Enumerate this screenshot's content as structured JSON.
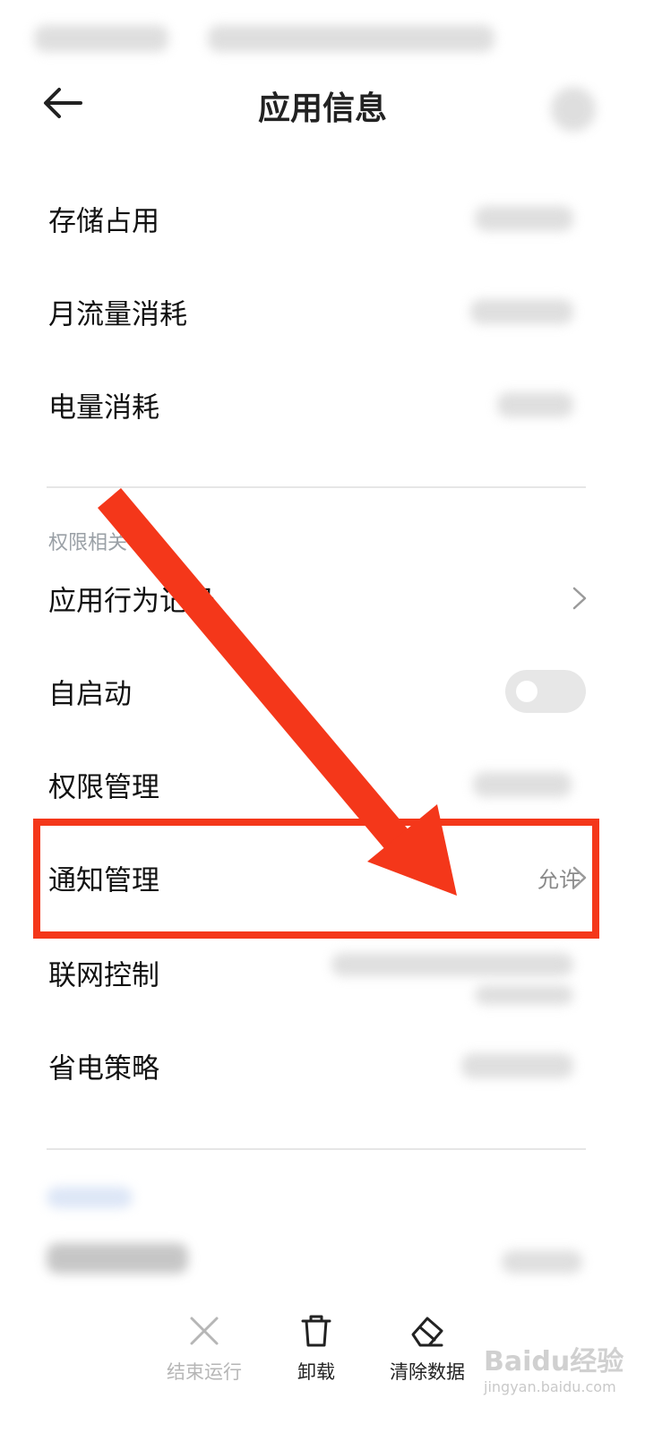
{
  "header": {
    "title": "应用信息"
  },
  "storage_section": {
    "items": [
      {
        "label": "存储占用"
      },
      {
        "label": "月流量消耗"
      },
      {
        "label": "电量消耗"
      }
    ]
  },
  "permissions_section": {
    "title": "权限相关",
    "items": [
      {
        "label": "应用行为记录"
      },
      {
        "label": "自启动",
        "toggle_on": false
      },
      {
        "label": "权限管理"
      },
      {
        "label": "通知管理",
        "value": "允许"
      },
      {
        "label": "联网控制"
      },
      {
        "label": "省电策略"
      }
    ]
  },
  "bottom_bar": {
    "stop": "结束运行",
    "uninstall": "卸载",
    "clear": "清除数据"
  },
  "watermark": {
    "text": "Baidu经验",
    "sub": "jingyan.baidu.com"
  },
  "colors": {
    "annotation_red": "#f4371a",
    "muted_text": "#8a8a8a"
  },
  "icons": {
    "back": "arrow-left-icon",
    "chevron": "chevron-right-icon",
    "stop": "close-icon",
    "uninstall": "trash-icon",
    "clear": "eraser-icon"
  }
}
